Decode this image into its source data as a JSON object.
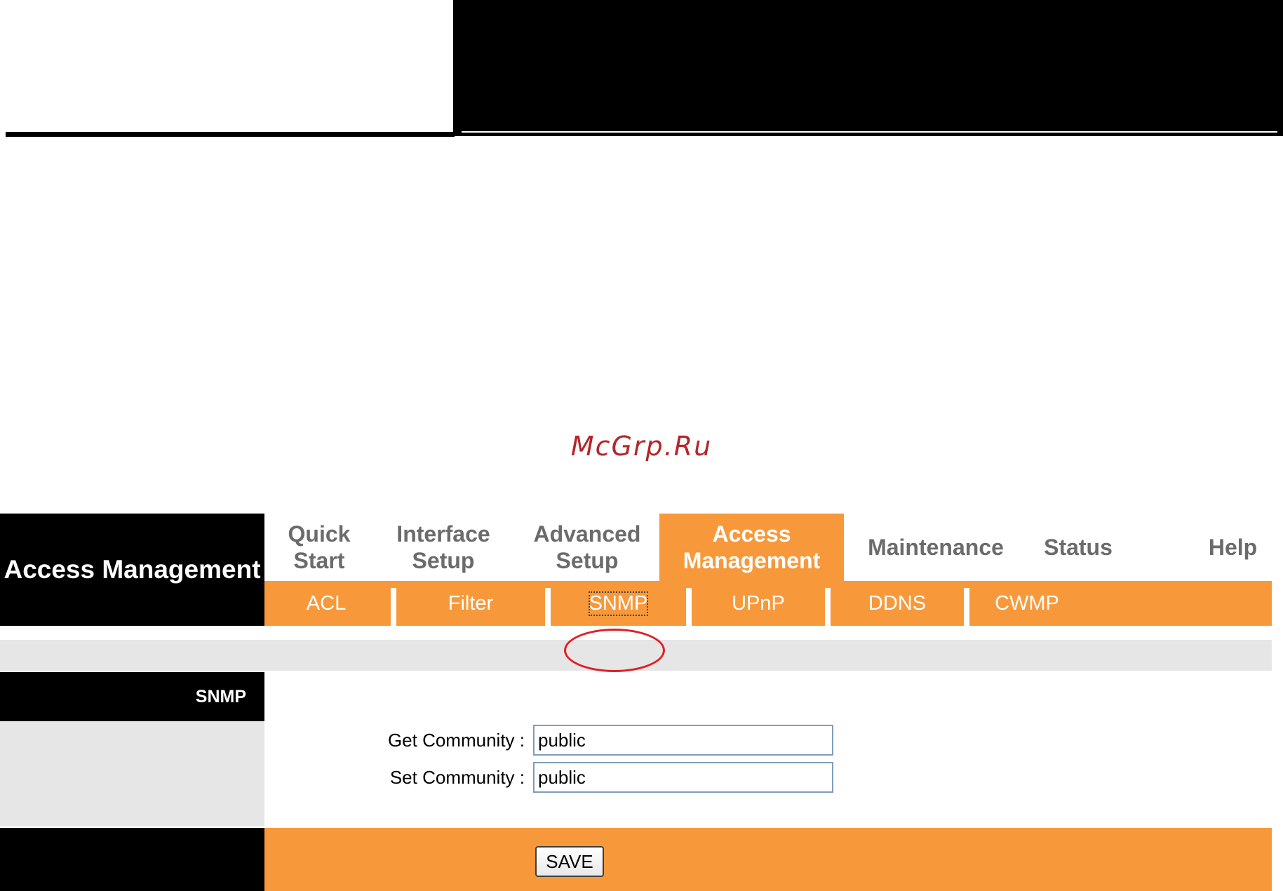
{
  "watermark": "McGrp.Ru",
  "page_title": "Access Management",
  "main_nav": [
    {
      "label": "Quick Start",
      "active": false
    },
    {
      "label": "Interface Setup",
      "active": false
    },
    {
      "label": "Advanced Setup",
      "active": false
    },
    {
      "label": "Access Management",
      "active": true
    },
    {
      "label": "Maintenance",
      "active": false
    },
    {
      "label": "Status",
      "active": false
    },
    {
      "label": "Help",
      "active": false
    }
  ],
  "sub_nav": [
    {
      "label": "ACL",
      "active": false
    },
    {
      "label": "Filter",
      "active": false
    },
    {
      "label": "SNMP",
      "active": true
    },
    {
      "label": "UPnP",
      "active": false
    },
    {
      "label": "DDNS",
      "active": false
    },
    {
      "label": "CWMP",
      "active": false
    }
  ],
  "section": {
    "label": "SNMP"
  },
  "form": {
    "get_community": {
      "label": "Get Community :",
      "value": "public"
    },
    "set_community": {
      "label": "Set Community :",
      "value": "public"
    }
  },
  "buttons": {
    "save": "SAVE"
  },
  "colors": {
    "accent_orange": "#f7993b",
    "header_black": "#000000",
    "panel_grey": "#e6e6e6",
    "tab_inactive_text": "#6b6b6b",
    "annotation_red": "#e31e24",
    "watermark_red": "#b3262a"
  }
}
